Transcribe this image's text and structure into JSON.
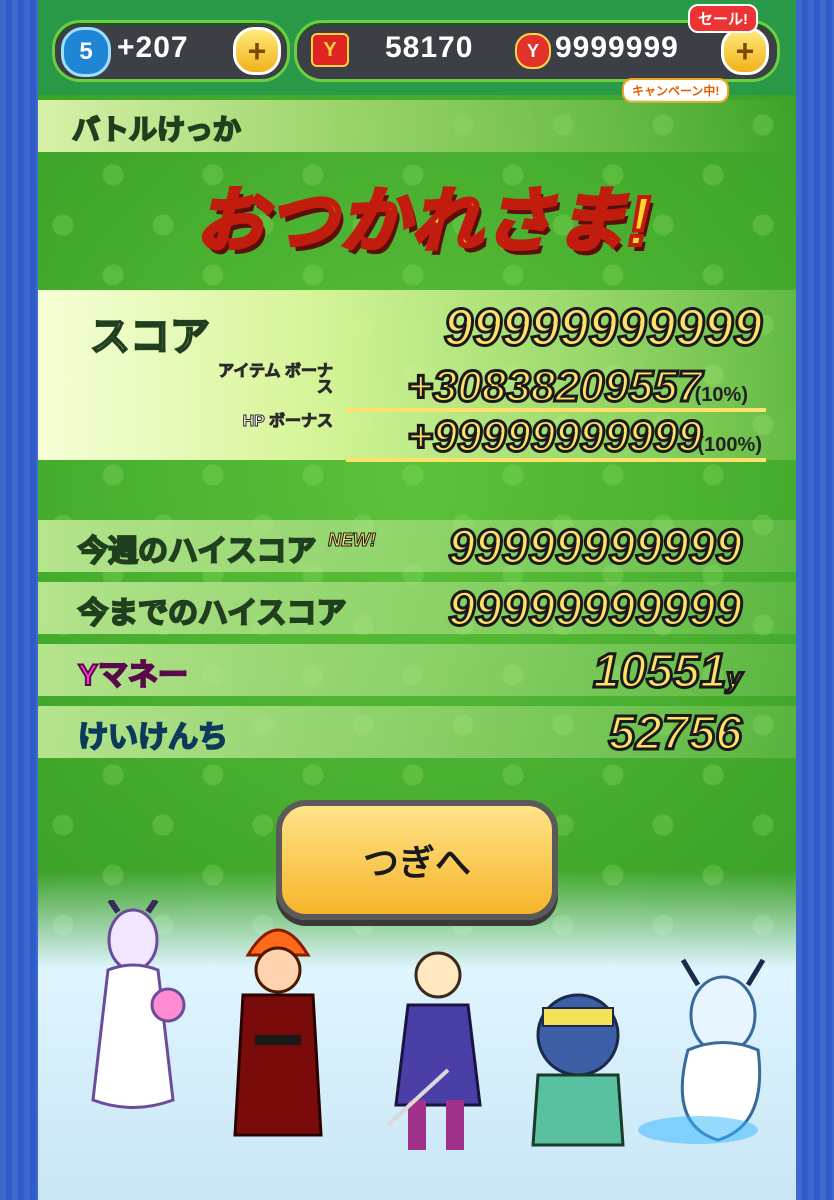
{
  "topbar": {
    "level": "5",
    "stamina_bonus": "+207",
    "money": "58170",
    "coins": "9999999",
    "sale_label": "セール!",
    "campaign_label": "キャンペーン中!",
    "plus_symbol": "+",
    "y_symbol": "Y"
  },
  "header": {
    "title": "バトルけっか"
  },
  "result": {
    "headline": "おつかれさま!",
    "score_label": "スコア",
    "score_value": "99999999999",
    "item_bonus_label": "アイテム ボーナス",
    "item_bonus_value": "+30838209557",
    "item_bonus_pct": "(10%)",
    "hp_bonus_label": "HP ボーナス",
    "hp_bonus_value": "+99999999999",
    "hp_bonus_pct": "(100%)"
  },
  "stats": {
    "weekly_high_label": "今週のハイスコア",
    "weekly_high_new": "NEW!",
    "weekly_high_value": "99999999999",
    "alltime_high_label": "今までのハイスコア",
    "alltime_high_value": "99999999999",
    "ymoney_label": "Yマネー",
    "ymoney_value": "10551",
    "ymoney_unit": "y",
    "exp_label": "けいけんち",
    "exp_value": "52756"
  },
  "next_button": {
    "label": "つぎへ"
  },
  "icons": [
    "level-badge",
    "y-money-icon",
    "coin-icon",
    "plus-icon"
  ],
  "colors": {
    "accent": "#ffe06a",
    "green": "#3fa52a",
    "button": "#f6b52a"
  }
}
